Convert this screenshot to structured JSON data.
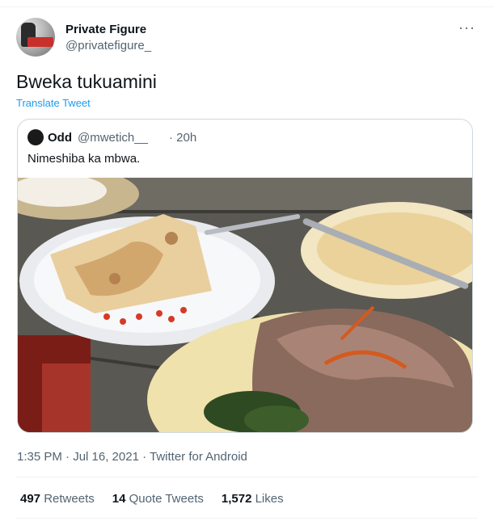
{
  "author": {
    "name": "Private Figure",
    "handle": "@privatefigure_"
  },
  "tweet": {
    "text": "Bweka tukuamini",
    "translate_label": "Translate Tweet"
  },
  "quoted": {
    "name": "Odd",
    "handle": "@mwetich__",
    "time": "· 20h",
    "text": "Nimeshiba ka mbwa."
  },
  "meta": {
    "timestamp": "1:35 PM · Jul 16, 2021 · Twitter for Android"
  },
  "stats": {
    "retweets_count": "497",
    "retweets_label": "Retweets",
    "quotes_count": "14",
    "quotes_label": "Quote Tweets",
    "likes_count": "1,572",
    "likes_label": "Likes"
  },
  "icons": {
    "more": "more-icon"
  },
  "colors": {
    "link": "#1d9bf0",
    "secondary_text": "#536471",
    "border": "#cfd9de"
  }
}
